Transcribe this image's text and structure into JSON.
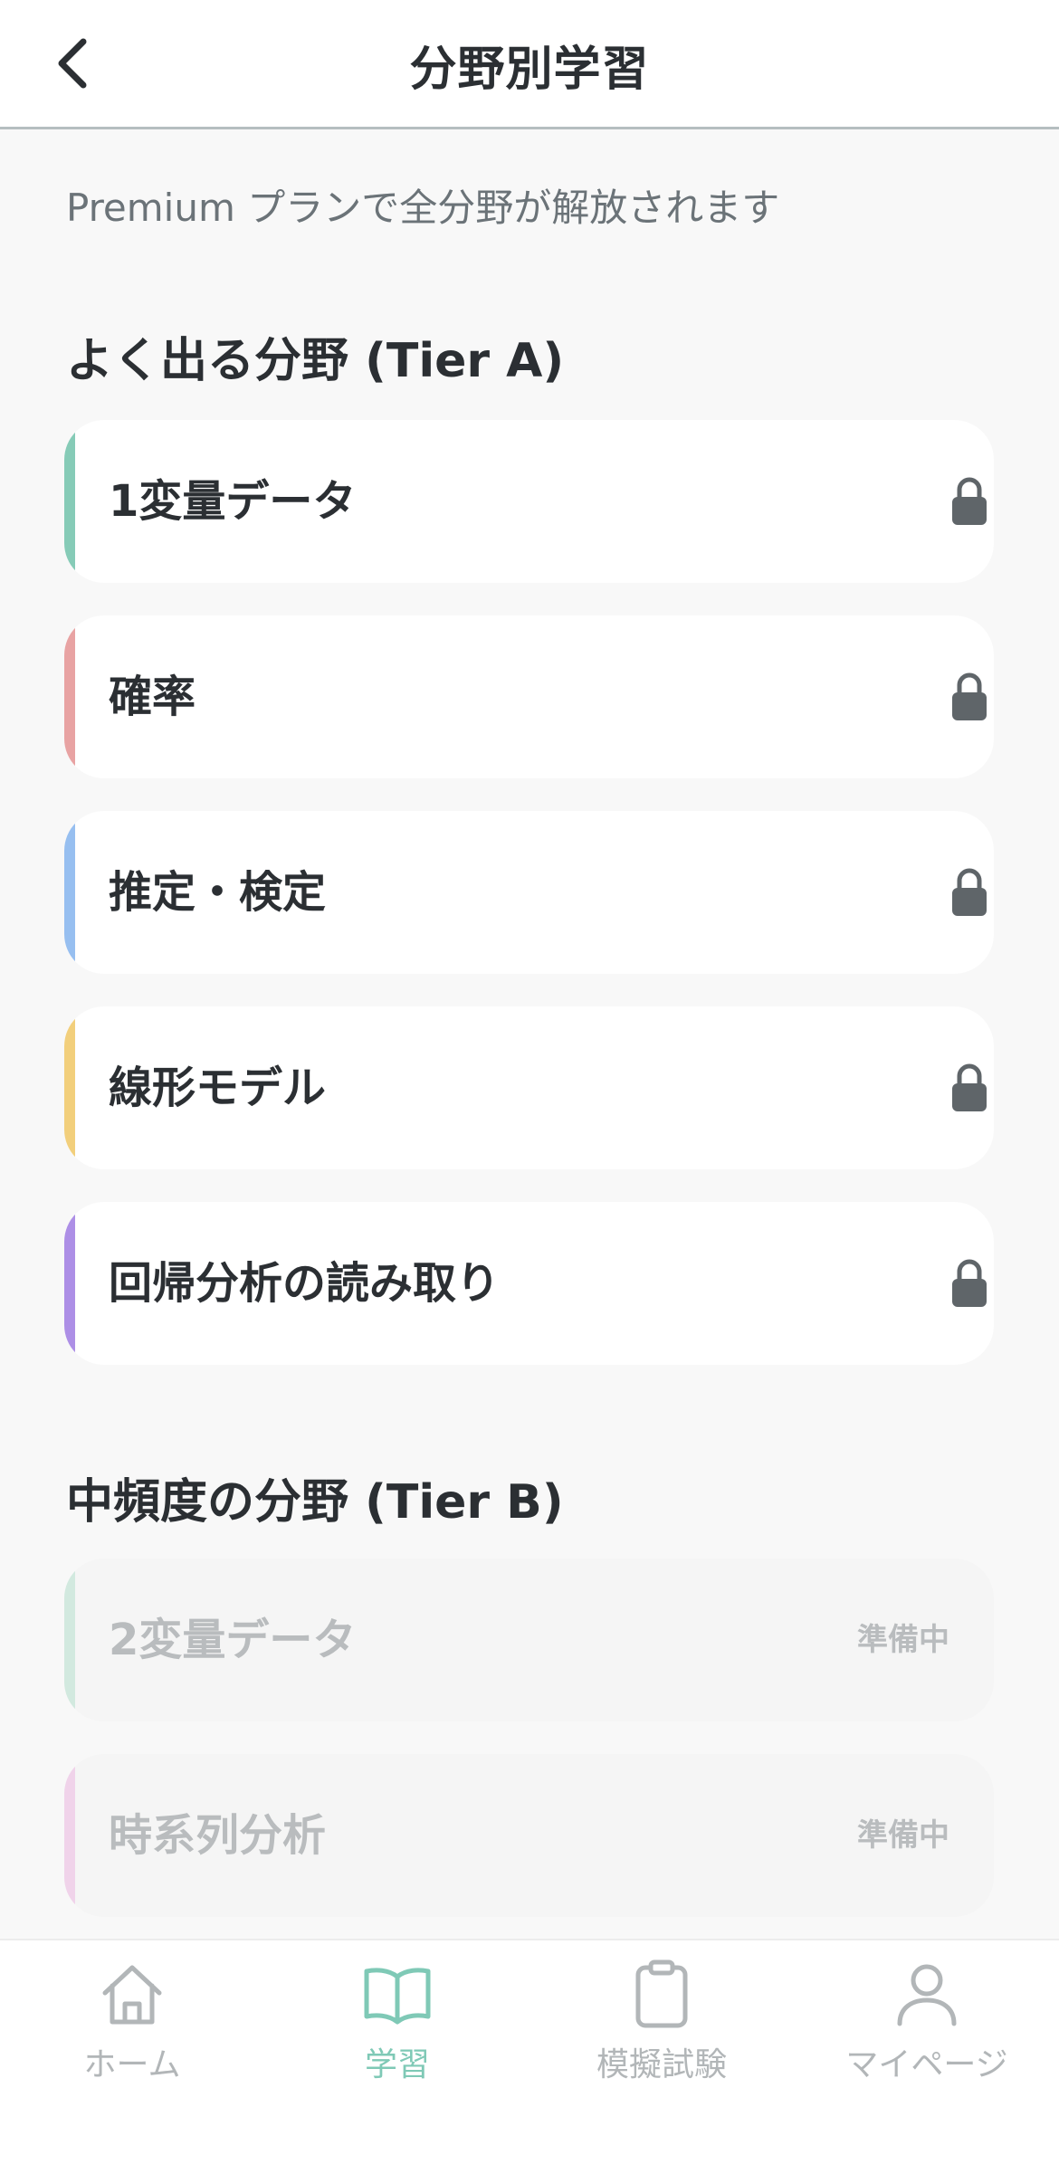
{
  "header": {
    "title": "分野別学習",
    "back_icon": "chevron-left-icon"
  },
  "notice": "Premium プランで全分野が解放されます",
  "sections": [
    {
      "title": "よく出る分野 (Tier A)",
      "items": [
        {
          "label": "1変量データ",
          "accent": "#86cbb7",
          "status": "locked"
        },
        {
          "label": "確率",
          "accent": "#e8a3a3",
          "status": "locked"
        },
        {
          "label": "推定・検定",
          "accent": "#97bff0",
          "status": "locked"
        },
        {
          "label": "線形モデル",
          "accent": "#f2cf7c",
          "status": "locked"
        },
        {
          "label": "回帰分析の読み取り",
          "accent": "#ad8fe6",
          "status": "locked"
        }
      ]
    },
    {
      "title": "中頻度の分野 (Tier B)",
      "items": [
        {
          "label": "2変量データ",
          "accent": "#d2e9df",
          "status": "coming_soon",
          "badge": "準備中"
        },
        {
          "label": "時系列分析",
          "accent": "#f0d3ea",
          "status": "coming_soon",
          "badge": "準備中"
        }
      ]
    }
  ],
  "lock_icon": "lock-icon",
  "colors": {
    "accent_active": "#7fc9b6",
    "inactive": "#b2b6b8",
    "lock": "#5f6569"
  },
  "tabbar": {
    "tabs": [
      {
        "label": "ホーム",
        "icon": "home-icon",
        "active": false
      },
      {
        "label": "学習",
        "icon": "book-icon",
        "active": true
      },
      {
        "label": "模擬試験",
        "icon": "clipboard-icon",
        "active": false
      },
      {
        "label": "マイページ",
        "icon": "user-icon",
        "active": false
      }
    ]
  }
}
